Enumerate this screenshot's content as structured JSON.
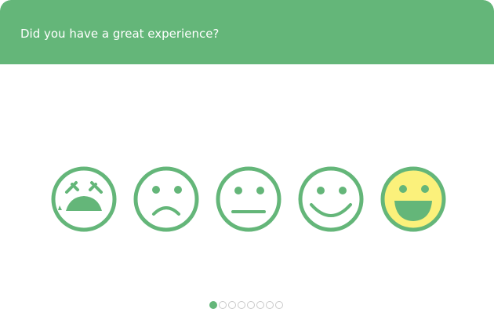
{
  "survey": {
    "question": "Did you have a great experience?"
  },
  "rating": {
    "options": [
      {
        "name": "very-unhappy-face-icon",
        "level": 1
      },
      {
        "name": "sad-face-icon",
        "level": 2
      },
      {
        "name": "neutral-face-icon",
        "level": 3
      },
      {
        "name": "smiling-face-icon",
        "level": 4
      },
      {
        "name": "laughing-face-icon",
        "level": 5
      }
    ],
    "selected_level": 5
  },
  "pagination": {
    "total_pages": 8,
    "current_page": 1
  },
  "colors": {
    "accent": "#64b679",
    "selected_fill": "#fbf17b",
    "header_text": "#ffffff",
    "inactive_dot_border": "#c9c9c9"
  }
}
